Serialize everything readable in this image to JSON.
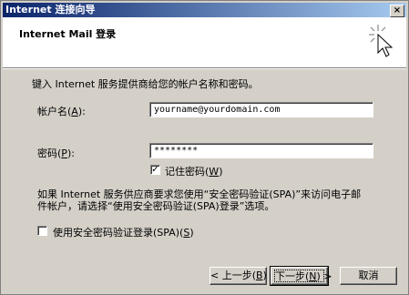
{
  "window": {
    "title": "Internet 连接向导",
    "close_glyph": "×"
  },
  "header": {
    "title": "Internet Mail 登录",
    "icon": "wizard-cursor-icon"
  },
  "intro": "键入 Internet 服务提供商给您的帐户名称和密码。",
  "account": {
    "label": "帐户名",
    "accel": "A",
    "value": "yourname@yourdomain.com"
  },
  "password": {
    "label": "密码",
    "accel": "P",
    "value": "********"
  },
  "remember": {
    "label": "记住密码",
    "accel": "W",
    "checked": true,
    "check_glyph": "✓"
  },
  "spa_note": {
    "line1": "如果 Internet 服务供应商要求您使用“安全密码验证(SPA)”来访问电子邮",
    "line2": "件帐户，请选择“使用安全密码验证(SPA)登录”选项。"
  },
  "spa": {
    "label": "使用安全密码验证登录(SPA)",
    "accel": "S",
    "checked": false
  },
  "buttons": {
    "back": {
      "prefix": "< 上一步(",
      "accel": "B",
      "suffix": ")"
    },
    "next": {
      "prefix": "下一步(",
      "accel": "N",
      "suffix": ") >"
    },
    "cancel": "取消"
  }
}
